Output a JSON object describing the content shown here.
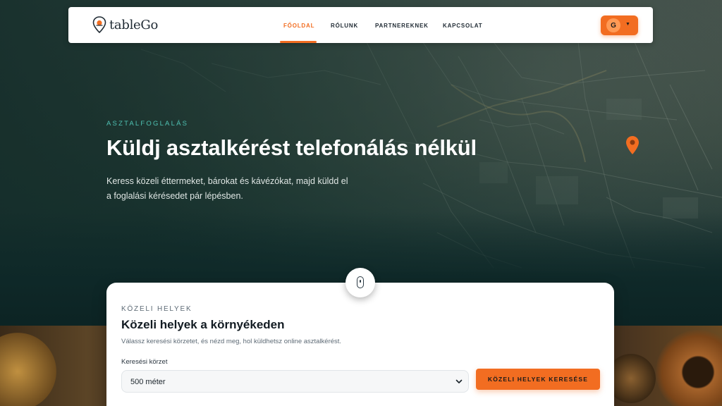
{
  "brand": {
    "logo_text": "tableGo"
  },
  "nav": {
    "items": [
      {
        "label": "FŐOLDAL",
        "active": true
      },
      {
        "label": "RÓLUNK",
        "active": false
      },
      {
        "label": "PARTNEREKNEK",
        "active": false
      },
      {
        "label": "KAPCSOLAT",
        "active": false
      }
    ],
    "user_initial": "G",
    "user_caret": "▼"
  },
  "hero": {
    "eyebrow": "ASZTALFOGLALÁS",
    "title": "Küldj asztalkérést telefonálás nélkül",
    "subtitle": "Keress közeli éttermeket, bárokat és kávézókat, majd küldd el a foglalási kérésedet pár lépésben."
  },
  "nearby": {
    "eyebrow": "KÖZELI HELYEK",
    "title": "Közeli helyek a környékeden",
    "description": "Válassz keresési körzetet, és nézd meg, hol küldhetsz online asztalkérést.",
    "radius_label": "Keresési körzet",
    "radius_value": "500 méter",
    "search_button": "KÖZELI HELYEK KERESÉSE"
  },
  "colors": {
    "accent": "#f26d21",
    "teal": "#4fc2b3",
    "hero_bg": "#0f2a2a"
  },
  "icons": {
    "logo": "location-pin-plate-icon",
    "map_pin": "map-pin-icon",
    "scroll": "mouse-scroll-icon",
    "chevron": "chevron-down-icon"
  }
}
